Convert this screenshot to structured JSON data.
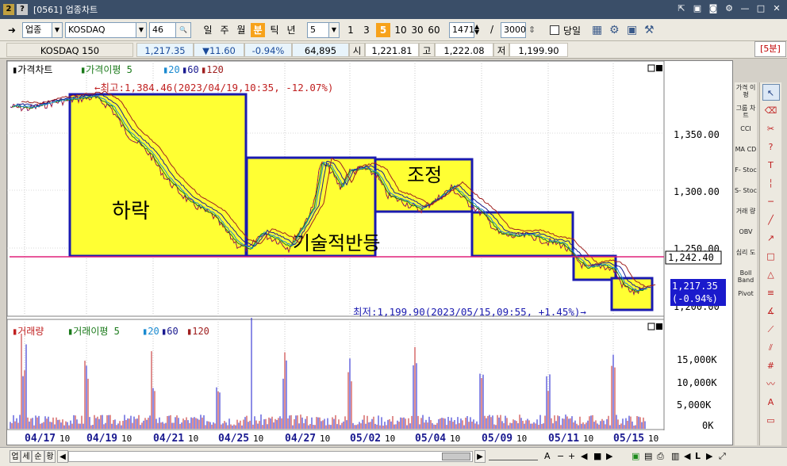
{
  "window": {
    "code": "[0561]",
    "title": "업종차트"
  },
  "toolbar": {
    "market_type": "업종",
    "index_name": "KOSDAQ",
    "count_value": "46",
    "periods": [
      "일",
      "주",
      "월",
      "분",
      "틱",
      "년"
    ],
    "active_period": "분",
    "minute_select": "5",
    "minute_buttons": [
      "1",
      "3",
      "5",
      "10",
      "30",
      "60"
    ],
    "active_minute": "5",
    "visible_bars": "1471",
    "total_bars": "3000",
    "today_label": "당일"
  },
  "quote": {
    "name": "KOSDAQ 150",
    "price": "1,217.35",
    "change": "▼11.60",
    "change_pct": "-0.94%",
    "volume": "64,895",
    "open_label": "시",
    "open": "1,221.81",
    "high_label": "고",
    "high": "1,222.08",
    "low_label": "저",
    "low": "1,199.90",
    "interval_badge": "[5분]"
  },
  "price_panel": {
    "legend_title": "가격차트",
    "legend_ma_label": "가격이평",
    "ma_periods": [
      "5",
      "20",
      "60",
      "120"
    ],
    "ma_colors": [
      "#1a7a1a",
      "#1a8ad0",
      "#1a1a90",
      "#a02020"
    ],
    "high_annotation": "←최고:1,384.46(2023/04/19,10:35, -12.07%)",
    "low_annotation": "최저:1,199.90(2023/05/15,09:55, +1.45%)→",
    "y_ticks": [
      "1,350.00",
      "1,300.00",
      "1,250.00",
      "1,200.00"
    ],
    "support_level": "1,242.40",
    "current_price": "1,217.35",
    "current_pct": "(-0.94%)",
    "zones": [
      {
        "label": "하락"
      },
      {
        "label": "기술적반등"
      },
      {
        "label": "조정"
      },
      {
        "label": ""
      },
      {
        "label": ""
      },
      {
        "label": ""
      }
    ],
    "support_color": "#e0207a",
    "zone_fill": "#ffff33",
    "zone_border": "#1a1ab0"
  },
  "volume_panel": {
    "legend_title": "거래량",
    "legend_ma_label": "거래이평",
    "ma_periods": [
      "5",
      "20",
      "60",
      "120"
    ],
    "y_ticks": [
      "15,000K",
      "10,000K",
      "5,000K",
      "0K"
    ]
  },
  "x_axis": {
    "labels": [
      "04/17",
      "04/19",
      "04/21",
      "04/25",
      "04/27",
      "05/02",
      "05/04",
      "05/09",
      "05/11",
      "05/15"
    ],
    "suffix": "10"
  },
  "indicator_panel": [
    "가격\n이평",
    "그룹\n차트",
    "CCI",
    "MA\nCD",
    "F-\nStoc",
    "S-\nStoc",
    "거래\n량",
    "OBV",
    "심리\n도",
    "Boll\nBand",
    "Pivot"
  ],
  "bottom_tabs": [
    "업",
    "세",
    "순",
    "황"
  ]
}
